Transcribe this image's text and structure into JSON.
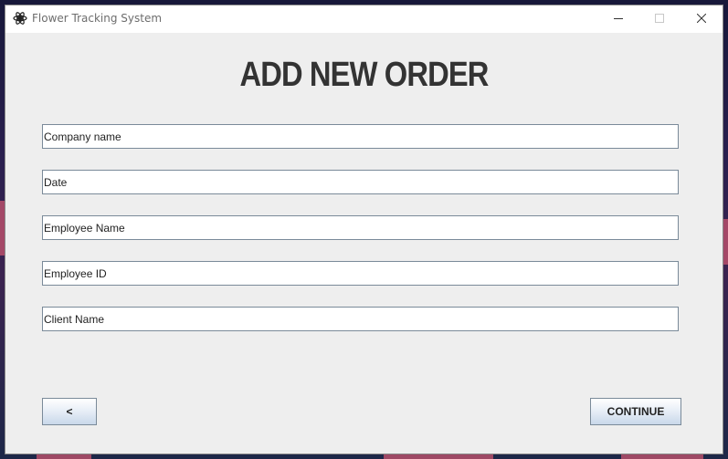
{
  "window": {
    "title": "Flower Tracking System",
    "icon": "app-flower-icon"
  },
  "controls": {
    "minimize_icon": "minimize-icon",
    "maximize_icon": "maximize-icon",
    "close_icon": "close-icon"
  },
  "form": {
    "heading": "ADD NEW ORDER",
    "fields": [
      {
        "name": "company-name",
        "value": "Company name"
      },
      {
        "name": "date",
        "value": "Date"
      },
      {
        "name": "employee-name",
        "value": "Employee Name"
      },
      {
        "name": "employee-id",
        "value": "Employee ID"
      },
      {
        "name": "client-name",
        "value": "Client Name"
      }
    ]
  },
  "buttons": {
    "back_label": "<",
    "continue_label": "CONTINUE"
  },
  "colors": {
    "window_bg": "#eeeeee",
    "heading": "#333333",
    "field_border": "#7a8a99"
  }
}
